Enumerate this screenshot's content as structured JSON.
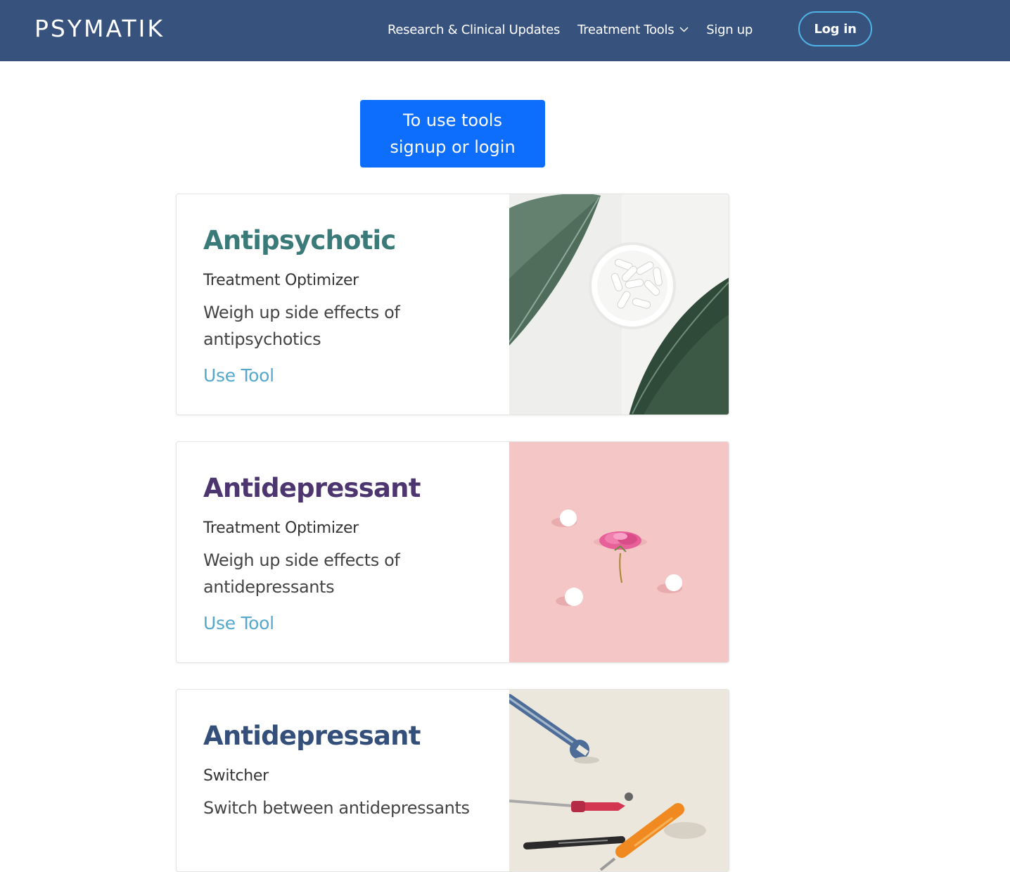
{
  "header": {
    "brand": "PSYMATIK",
    "nav": {
      "research": "Research & Clinical Updates",
      "tools": "Treatment Tools",
      "signup": "Sign up"
    },
    "login": "Log in",
    "bg_color": "#38527e"
  },
  "cta": {
    "label": "To use tools signup or login",
    "color": "#0d6efd"
  },
  "cards": [
    {
      "title": "Antipsychotic",
      "title_color": "#3a7a78",
      "subtitle": "Treatment Optimizer",
      "description": "Weigh up side effects of antipsychotics",
      "link": "Use Tool",
      "image": "pills-and-leaves-image"
    },
    {
      "title": "Antidepressant",
      "title_color": "#4d3670",
      "subtitle": "Treatment Optimizer",
      "description": "Weigh up side effects of antidepressants",
      "link": "Use Tool",
      "image": "pink-flower-image"
    },
    {
      "title": "Antidepressant",
      "title_color": "#34507a",
      "subtitle": "Switcher",
      "description": "Switch between antidepressants",
      "image": "tools-image"
    }
  ]
}
